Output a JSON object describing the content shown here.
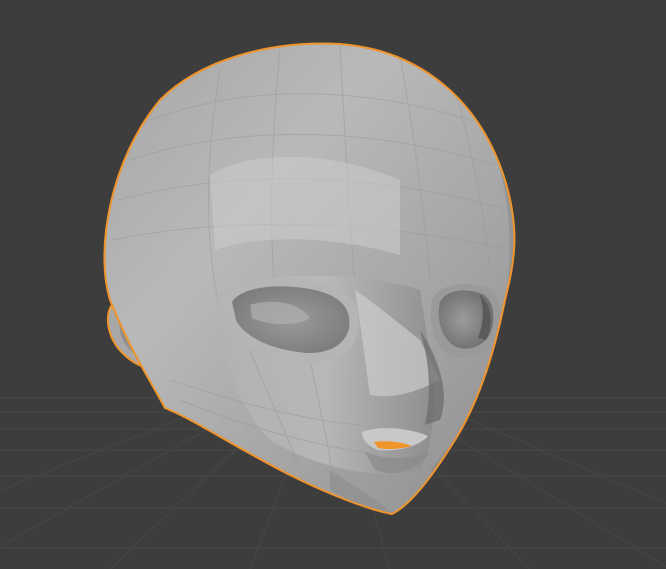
{
  "viewport": {
    "background_color": "#3d3d3d",
    "grid_color": "#4a4a4a",
    "grid_visible": true
  },
  "object": {
    "type": "head-mesh",
    "selected": true,
    "selection_outline_color": "#f0942c",
    "base_color": "#a9a9a9",
    "highlight_color": "#cfcfcf",
    "shadow_color": "#5d5d5d",
    "shading": "solid-flat"
  }
}
